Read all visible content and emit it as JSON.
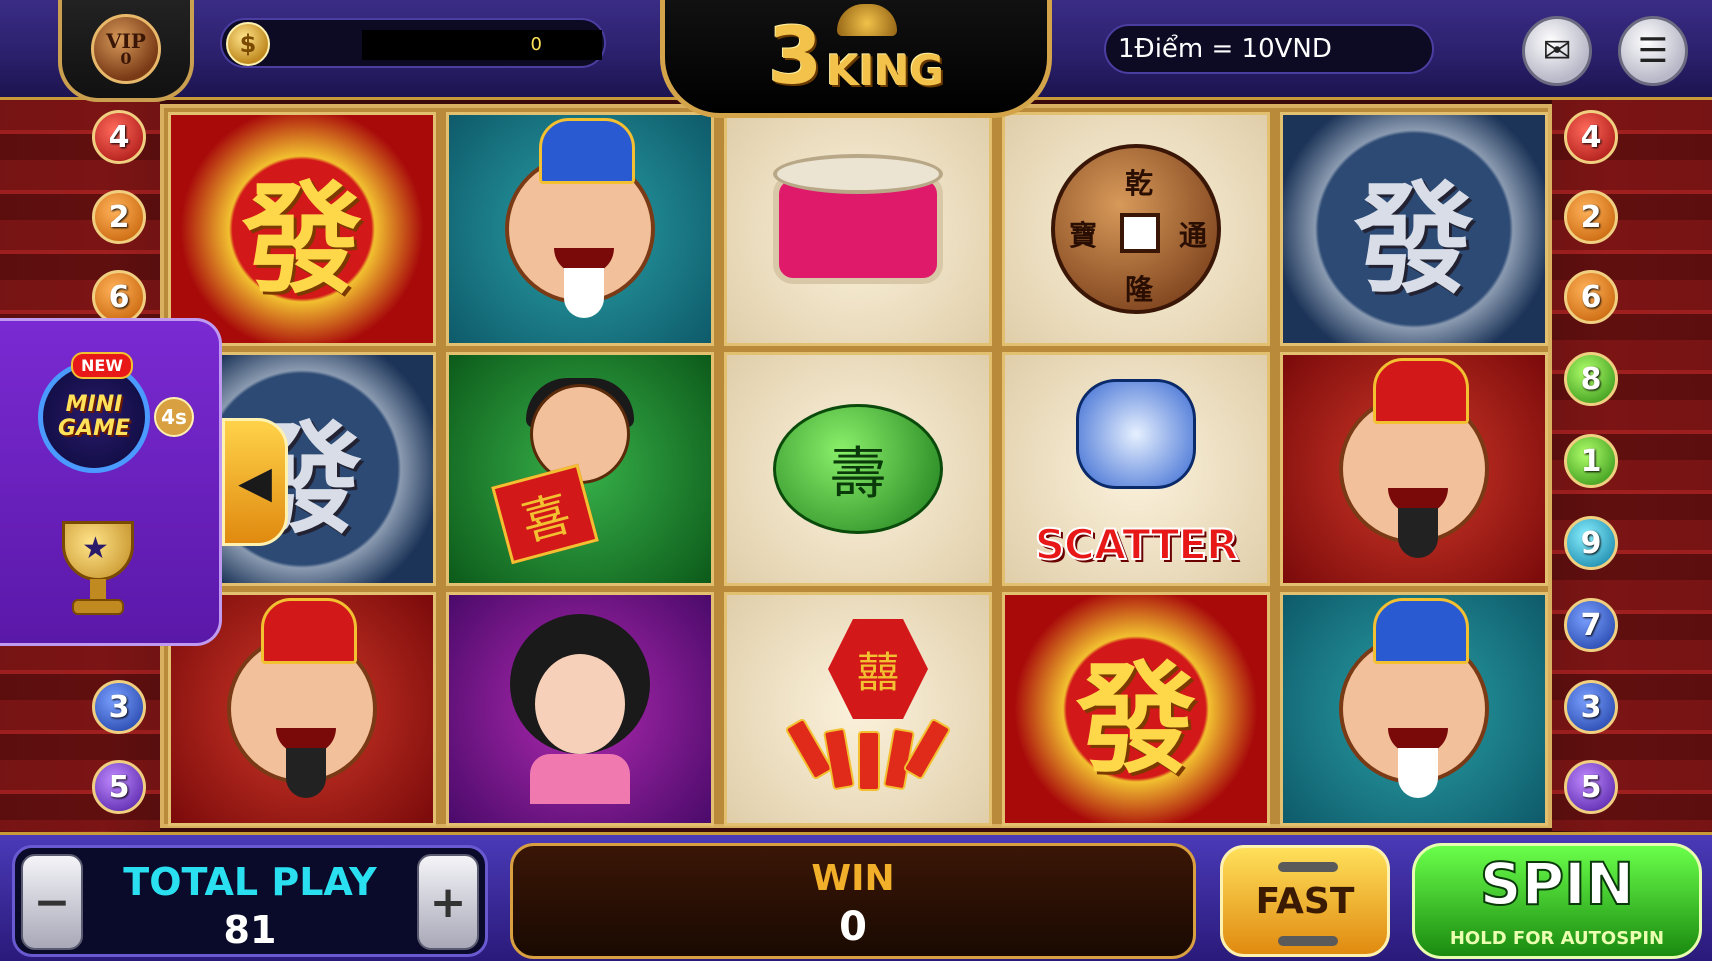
{
  "header": {
    "vip_label": "VIP",
    "vip_level": "0",
    "coin_symbol": "$",
    "balance": "0",
    "logo_number": "3",
    "logo_word": "KING",
    "rate": "1Điểm = 10VND"
  },
  "paylines": {
    "left": [
      "4",
      "2",
      "6",
      "3",
      "5"
    ],
    "right": [
      "4",
      "2",
      "6",
      "8",
      "1",
      "9",
      "7",
      "3",
      "5"
    ]
  },
  "reels": {
    "fa": "發",
    "coin_chars": [
      "乾",
      "隆",
      "寶",
      "通"
    ],
    "jade_char": "壽",
    "kid_char": "喜",
    "firework_char": "囍",
    "scatter": "SCATTER"
  },
  "side_panel": {
    "new_badge": "NEW",
    "mini_line1": "MINI",
    "mini_line2": "GAME",
    "timer": "4s"
  },
  "footer": {
    "total_play_label": "TOTAL PLAY",
    "total_play_value": "81",
    "minus": "−",
    "plus": "+",
    "win_label": "WIN",
    "win_value": "0",
    "fast_label": "FAST",
    "spin_label": "SPIN",
    "spin_sub": "HOLD FOR AUTOSPIN"
  },
  "icons": {
    "mail": "mail-icon",
    "menu": "menu-icon",
    "trophy": "trophy-icon",
    "collapse": "chevron-left-icon"
  },
  "colors": {
    "topbar": "#2a1f6a",
    "accent_gold": "#d4a44a",
    "total_play_text": "#2ae0f0",
    "win_text": "#f2b02a",
    "spin_green": "#1a8a10"
  }
}
